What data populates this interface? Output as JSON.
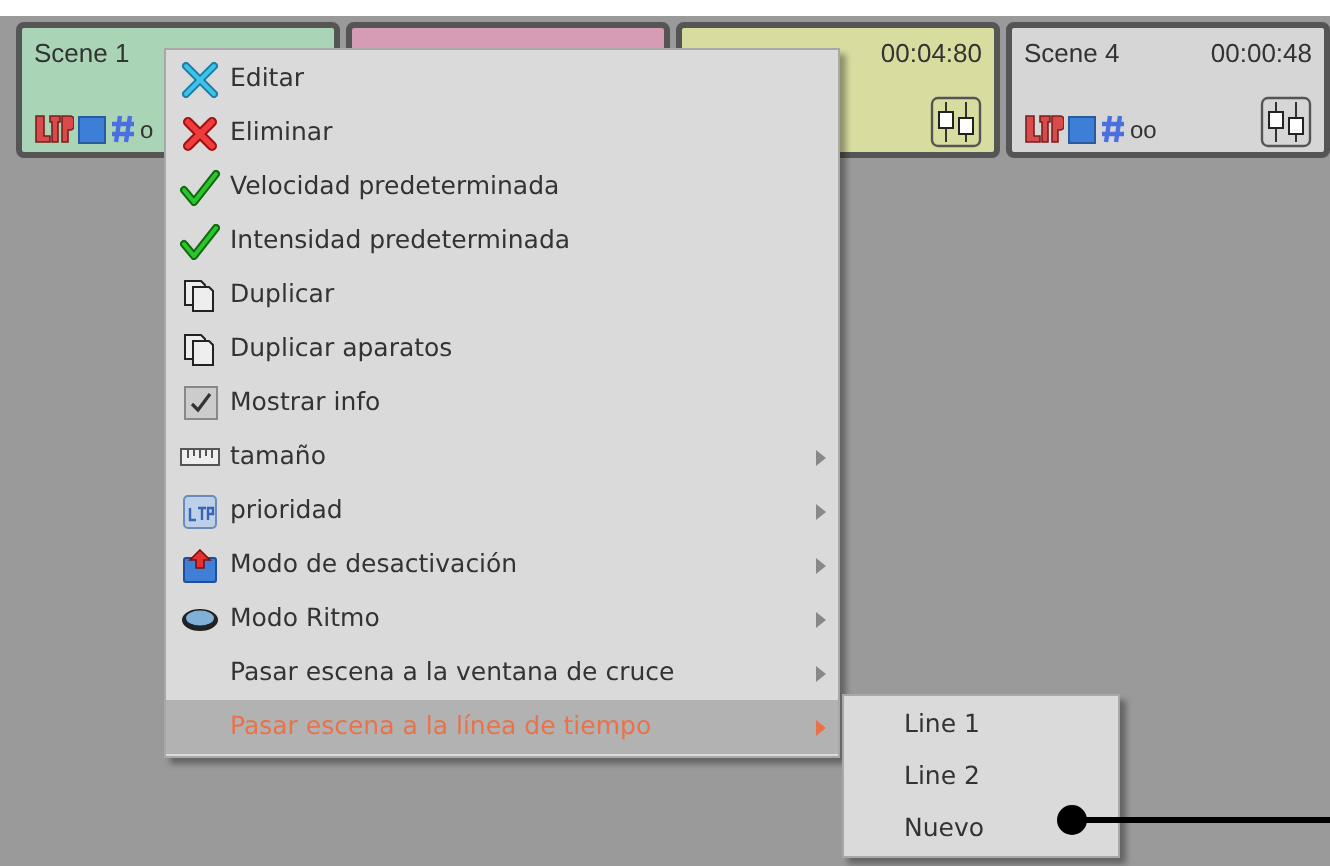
{
  "scenes": [
    {
      "name": "Scene 1",
      "info": "o",
      "color": "#a9d4b6",
      "faders": false
    },
    {
      "color": "#d79cb5",
      "faders": false
    },
    {
      "time": "00:04:80",
      "color": "#d9dc9f",
      "faders": true
    },
    {
      "name": "Scene 4",
      "time": "00:00:48",
      "info": "oo",
      "color": "#d6d6d6",
      "faders": true
    }
  ],
  "context_menu": {
    "items": [
      {
        "label": "Editar",
        "kind": "tools",
        "submenu": false,
        "selected": false
      },
      {
        "label": "Eliminar",
        "kind": "delete",
        "submenu": false,
        "selected": false
      },
      {
        "label": "Velocidad predeterminada",
        "kind": "check",
        "submenu": false,
        "selected": false
      },
      {
        "label": "Intensidad predeterminada",
        "kind": "check",
        "submenu": false,
        "selected": false
      },
      {
        "label": "Duplicar",
        "kind": "copy",
        "submenu": false,
        "selected": false
      },
      {
        "label": "Duplicar aparatos",
        "kind": "copy",
        "submenu": false,
        "selected": false
      },
      {
        "label": "Mostrar info",
        "kind": "checkbox",
        "submenu": false,
        "selected": false
      },
      {
        "label": "tamaño",
        "kind": "ruler",
        "submenu": true,
        "selected": false
      },
      {
        "label": "prioridad",
        "kind": "ltp",
        "submenu": true,
        "selected": false
      },
      {
        "label": "Modo de desactivación",
        "kind": "upload",
        "submenu": true,
        "selected": false
      },
      {
        "label": "Modo Ritmo",
        "kind": "disc",
        "submenu": true,
        "selected": false
      },
      {
        "label": "Pasar escena a la ventana de cruce",
        "kind": "plain",
        "submenu": true,
        "selected": false
      },
      {
        "label": "Pasar escena a la línea de tiempo",
        "kind": "plain",
        "submenu": true,
        "selected": true
      }
    ]
  },
  "submenu": {
    "items": [
      {
        "label": "Line 1"
      },
      {
        "label": "Line 2"
      },
      {
        "label": "Nuevo"
      }
    ]
  }
}
